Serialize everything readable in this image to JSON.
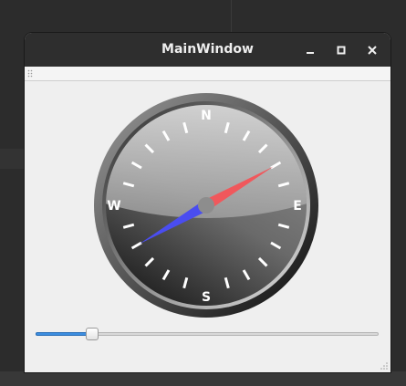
{
  "window": {
    "title": "MainWindow"
  },
  "compass": {
    "cardinals": {
      "north": "N",
      "east": "E",
      "south": "S",
      "west": "W"
    },
    "needle_heading_degrees": 60,
    "needle_colors": {
      "north": "#f0585c",
      "south": "#4a4df0"
    }
  },
  "slider": {
    "value_fraction": 0.165
  },
  "icons": {
    "minimize": "minimize-icon",
    "maximize": "maximize-icon",
    "close": "close-icon"
  },
  "colors": {
    "titlebar": "#2e2e2e",
    "window_background": "#efefef",
    "slider_accent": "#3d8ee0"
  }
}
